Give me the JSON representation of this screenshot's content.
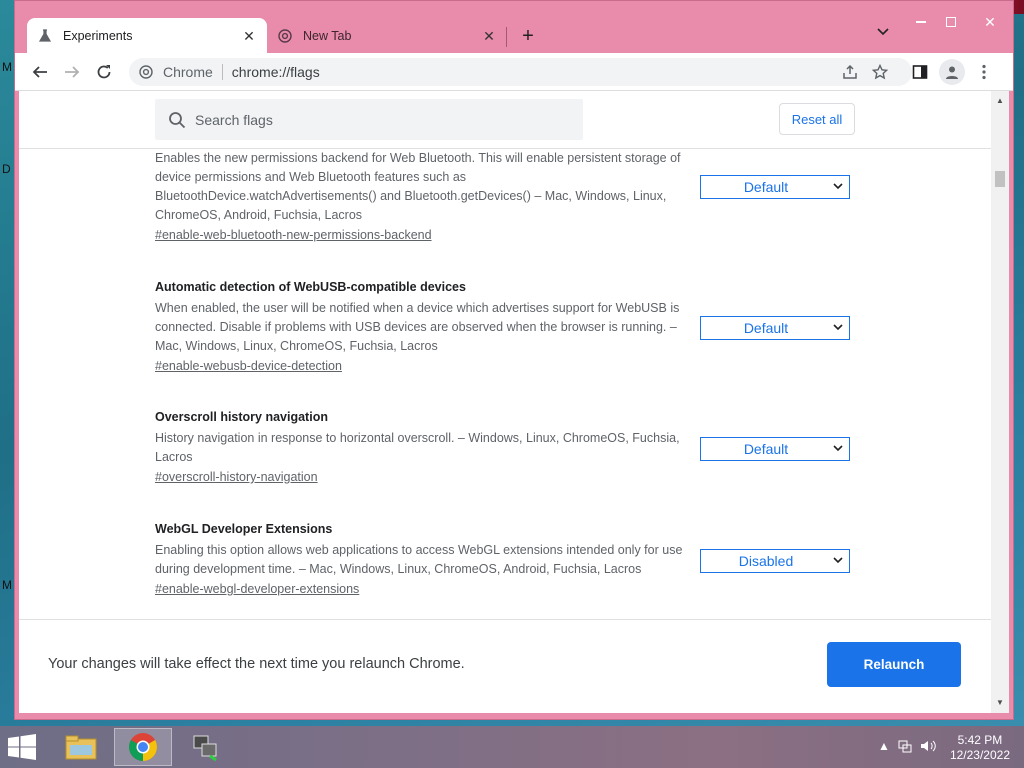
{
  "browser": {
    "tabs": [
      {
        "label": "Experiments",
        "icon": "flask-icon",
        "active": true
      },
      {
        "label": "New Tab",
        "icon": "chrome-icon",
        "active": false
      }
    ],
    "omnibox": {
      "site_label": "Chrome",
      "url": "chrome://flags"
    }
  },
  "flags_page": {
    "search_placeholder": "Search flags",
    "reset_label": "Reset all",
    "flags": [
      {
        "title": "",
        "description": "Enables the new permissions backend for Web Bluetooth. This will enable persistent storage of device permissions and Web Bluetooth features such as BluetoothDevice.watchAdvertisements() and Bluetooth.getDevices() – Mac, Windows, Linux, ChromeOS, Android, Fuchsia, Lacros",
        "anchor": "#enable-web-bluetooth-new-permissions-backend",
        "value": "Default"
      },
      {
        "title": "Automatic detection of WebUSB-compatible devices",
        "description": "When enabled, the user will be notified when a device which advertises support for WebUSB is connected. Disable if problems with USB devices are observed when the browser is running. – Mac, Windows, Linux, ChromeOS, Fuchsia, Lacros",
        "anchor": "#enable-webusb-device-detection",
        "value": "Default"
      },
      {
        "title": "Overscroll history navigation",
        "description": "History navigation in response to horizontal overscroll. – Windows, Linux, ChromeOS, Fuchsia, Lacros",
        "anchor": "#overscroll-history-navigation",
        "value": "Default"
      },
      {
        "title": "WebGL Developer Extensions",
        "description": "Enabling this option allows web applications to access WebGL extensions intended only for use during development time. – Mac, Windows, Linux, ChromeOS, Android, Fuchsia, Lacros",
        "anchor": "#enable-webgl-developer-extensions",
        "value": "Disabled"
      }
    ],
    "footer": {
      "message": "Your changes will take effect the next time you relaunch Chrome.",
      "relaunch_label": "Relaunch"
    }
  },
  "taskbar": {
    "items": [
      "file-explorer-icon",
      "chrome-icon",
      "network-app-icon"
    ],
    "time": "5:42 PM",
    "date": "12/23/2022"
  },
  "desktop": {
    "edge_letters": [
      "M",
      "D",
      "M"
    ]
  },
  "colors": {
    "accent": "#1a73e8",
    "frame": "#e98bab"
  }
}
